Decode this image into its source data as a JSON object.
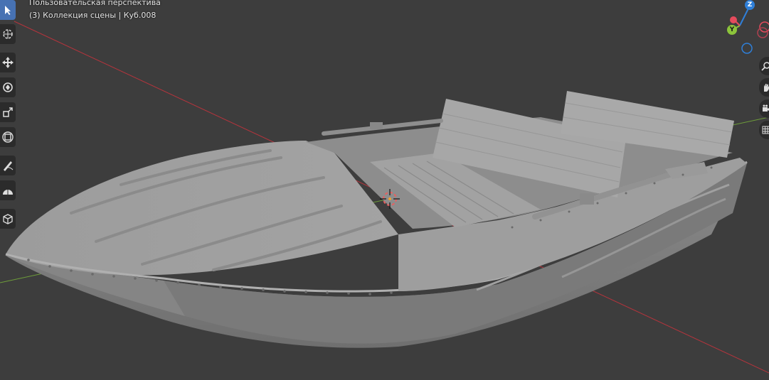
{
  "viewport": {
    "view_name": "Пользовательская перспектива",
    "scene_info": "(3) Коллекция сцены | Куб.008"
  },
  "gizmo": {
    "z_label": "Z",
    "y_label": "Y",
    "colors": {
      "x": "#e54b5c",
      "y": "#8cc43b",
      "z": "#2f7fd8"
    }
  },
  "toolbar": {
    "tools": [
      "select-box-icon",
      "cursor-icon",
      "move-icon",
      "rotate-icon",
      "scale-icon",
      "transform-icon",
      "annotate-icon",
      "measure-icon",
      "add-cube-icon"
    ],
    "active_tool": "select-box-icon"
  },
  "nav_buttons": [
    "zoom-icon",
    "pan-hand-icon",
    "camera-icon",
    "grid-ortho-icon"
  ],
  "colors": {
    "background": "#3d3d3d",
    "x_axis": "#b5343d",
    "y_axis": "#6e9d3a",
    "mesh": "#9a9a9a",
    "active_tool": "#4772b3"
  }
}
